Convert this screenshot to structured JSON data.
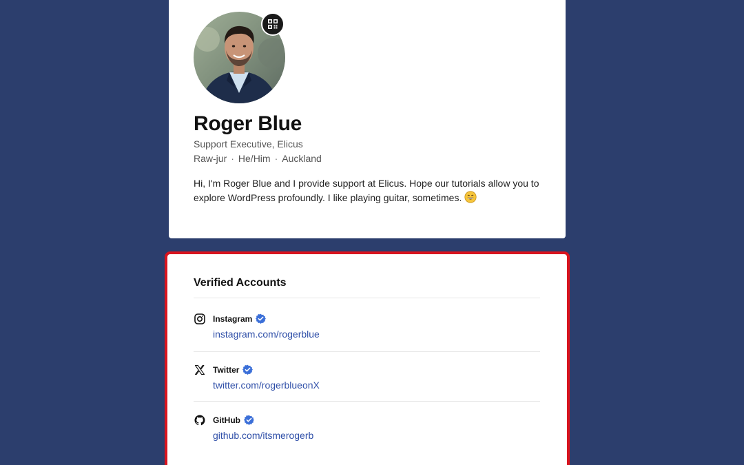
{
  "profile": {
    "name": "Roger Blue",
    "role": "Support Executive, Elicus",
    "pronunciation": "Raw-jur",
    "pronouns": "He/Him",
    "location": "Auckland",
    "separator": "·",
    "bio": "Hi, I'm Roger Blue and I provide support at Elicus. Hope our tutorials allow you to explore WordPress profoundly. I like playing guitar, sometimes.",
    "bio_emoji": "grinning-face-icon",
    "qr_icon": "qr-code-icon"
  },
  "verified_accounts": {
    "title": "Verified Accounts",
    "badge_icon": "verified-badge-icon",
    "items": [
      {
        "name": "Instagram",
        "link": "instagram.com/rogerblue",
        "icon": "instagram-icon"
      },
      {
        "name": "Twitter",
        "link": "twitter.com/rogerblueonX",
        "icon": "x-icon"
      },
      {
        "name": "GitHub",
        "link": "github.com/itsmerogerb",
        "icon": "github-icon"
      }
    ]
  },
  "colors": {
    "background": "#2c3e6d",
    "card": "#ffffff",
    "highlight_border": "#d9141e",
    "link": "#2f4fa8",
    "verified_badge": "#3b6fd8"
  }
}
